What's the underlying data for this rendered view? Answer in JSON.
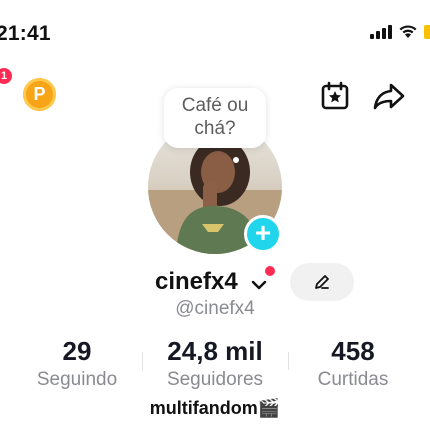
{
  "status_bar": {
    "time": "21:41",
    "icons": [
      "signal-icon",
      "wifi-icon",
      "battery-icon"
    ]
  },
  "top_bar": {
    "notification_count": "1",
    "points_badge_letter": "P",
    "calendar_icon": "calendar-star-icon",
    "share_icon": "share-arrow-icon"
  },
  "profile": {
    "note_bubble": [
      "Café ou",
      "chá?"
    ],
    "username": "cinefx4",
    "handle": "@cinefx4",
    "bio": "multifandom🎬"
  },
  "stats": [
    {
      "value": "29",
      "label": "Seguindo"
    },
    {
      "value": "24,8 mil",
      "label": "Seguidores"
    },
    {
      "value": "458",
      "label": "Curtidas"
    }
  ],
  "colors": {
    "accent_red": "#fe2c55",
    "add_button": "#20d5ec",
    "points_badge": "#f7a416"
  }
}
